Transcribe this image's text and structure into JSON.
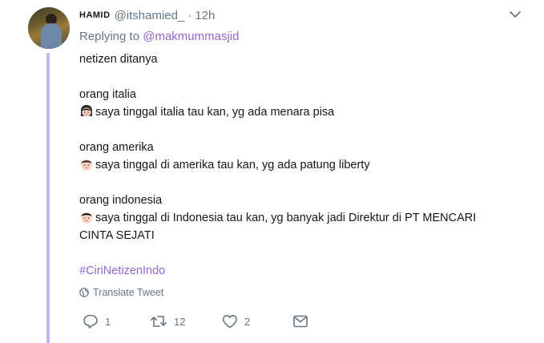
{
  "tweet": {
    "author_name": "HAMID",
    "handle": "@itshamied_",
    "separator": "·",
    "time": "12h",
    "replying_label": "Replying to",
    "replying_mention": "@makmummasjid",
    "lines": {
      "l1": "netizen ditanya",
      "l2": "orang italia",
      "l3": "saya tinggal italia tau kan, yg ada menara pisa",
      "l4": "orang amerika",
      "l5": "saya tinggal di amerika tau kan, yg ada patung liberty",
      "l6": "orang indonesia",
      "l7": "saya tinggal di Indonesia tau kan, yg banyak jadi Direktur di PT MENCARI",
      "l8": "CINTA SEJATI"
    },
    "hashtag": "#CiriNetizenIndo",
    "translate_label": "Translate Tweet",
    "actions": {
      "reply_count": "1",
      "retweet_count": "12",
      "like_count": "2"
    }
  },
  "icons": {
    "dropdown": "chevron-down-icon",
    "globe": "globe-icon",
    "reply": "reply-icon",
    "retweet": "retweet-icon",
    "like": "heart-icon",
    "dm": "envelope-icon",
    "emoji_woman": "woman-face-emoji",
    "emoji_man": "man-face-emoji"
  },
  "colors": {
    "accent": "#9266cc",
    "thread_line": "#c4b5f0",
    "secondary_text": "#657786"
  }
}
